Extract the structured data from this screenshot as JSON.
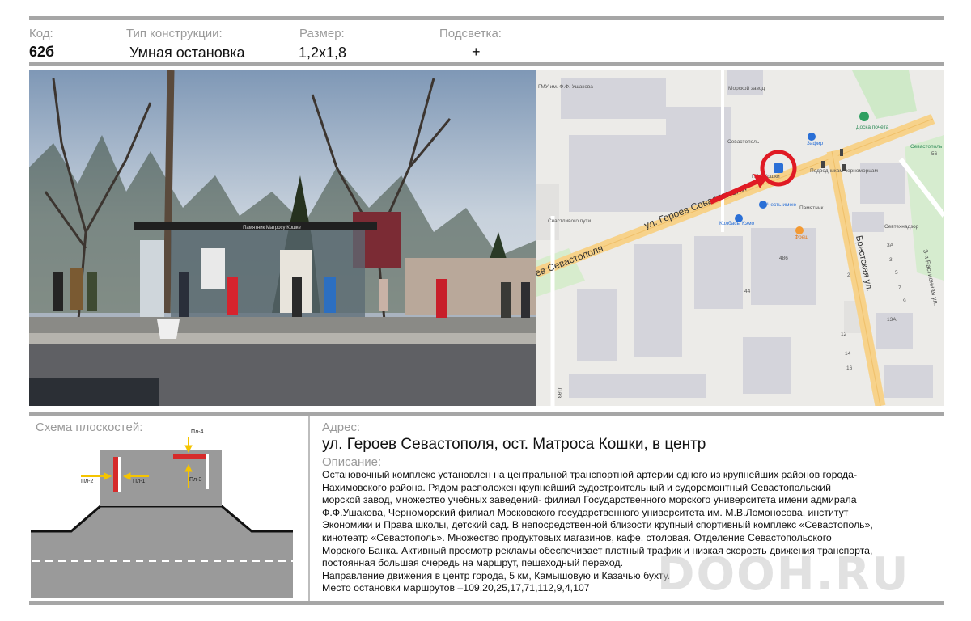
{
  "header": {
    "code_label": "Код:",
    "code_value": "62б",
    "type_label": "Тип конструкции:",
    "type_value": "Умная остановка",
    "size_label": "Размер:",
    "size_value": "1,2x1,8",
    "light_label": "Подсветка:",
    "light_value": "+"
  },
  "photo": {
    "sign_text": "Памятник Матросу Кошке"
  },
  "map": {
    "labels": {
      "ushakov": "ГМУ им. Ф.Ф. Ушакова",
      "morzavod": "Морской завод",
      "sevastopol": "Севастополь",
      "doska": "Доска почёта",
      "zafir": "Зафир",
      "koshka": "П.М. Кошки",
      "podvodnikam": "Подводникам черноморцам",
      "pamyatnik": "Памятник",
      "chest": "Честь имею",
      "kolbasy": "Колбасы Кэмо",
      "fresh": "Фреш",
      "schastliv": "Счастливого пути",
      "sevnadzor": "Севтехнадзор",
      "sev_right": "Севастополь",
      "street_main": "ул. Героев Севастополя",
      "street_left": "ев Севастополя",
      "street_brest": "Брестская ул.",
      "street_bast": "3-я Бастионная ул.",
      "street_laz": "Лаз",
      "n486": "486",
      "n44": "44",
      "n2": "2",
      "n3a": "3А",
      "n3": "3",
      "n5": "5",
      "n7": "7",
      "n9": "9",
      "n13a": "13А",
      "n12": "12",
      "n14": "14",
      "n16": "16",
      "n56": "56"
    }
  },
  "scheme": {
    "label": "Схема плоскостей:",
    "p1": "Пл-1",
    "p2": "Пл-2",
    "p3": "Пл-3",
    "p4": "Пл-4"
  },
  "address": {
    "label": "Адрес:",
    "value": "ул. Героев Севастополя, ост. Матроса Кошки, в центр"
  },
  "description": {
    "label": "Описание:",
    "lines": [
      "Остановочный комплекс установлен на центральной транспортной артерии  одного из крупнейших районов города-",
      "Нахимовского района. Рядом расположен крупнейший судостроительный и судоремонтный   Севастопольский",
      "морской завод, множество учебных заведений- филиал Государственного морского университета имени адмирала",
      "Ф.Ф.Ушакова, Черноморский филиал Московского государственного университета им.  М.В.Ломоносова, институт",
      "Экономики и Права школы, детский сад. В непосредственной близости крупный спортивный комплекс «Севастополь»,",
      "кинотеатр «Севастополь». Множество продуктовых магазинов, кафе, столовая. Отделение Севастопольского",
      "Морского Банка. Активный просмотр рекламы обеспечивает плотный трафик и низкая скорость движения транспорта,",
      "постоянная большая очередь на маршрут, пешеходный переход.",
      "Направление движения в центр города, 5 км, Камышовую и Казачью бухту.",
      "Место остановки маршрутов –109,20,25,17,71,112,9,4,107"
    ]
  },
  "watermark": "DOOH.RU",
  "colors": {
    "bar": "#a6a6a6",
    "accent_red": "#e02020",
    "road": "#9a9a9a",
    "marker_yellow": "#f5c400",
    "map_road": "#f7d28a"
  }
}
